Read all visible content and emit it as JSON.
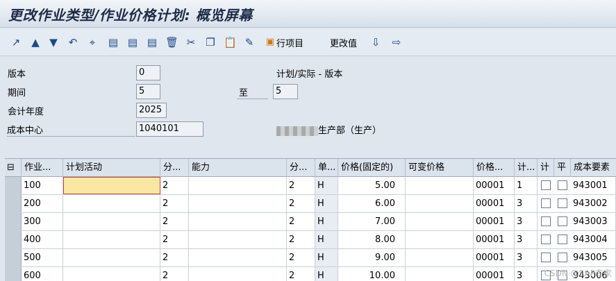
{
  "window": {
    "title": "更改作业类型/作业价格计划: 概览屏幕"
  },
  "toolbar": {
    "icons": [
      "chart-icon",
      "arrow-up-icon",
      "arrow-down-icon",
      "undo-icon",
      "select-icon",
      "doc-icon",
      "doc-icon",
      "doc-icon",
      "delete-icon",
      "cut-icon",
      "copy-icon",
      "paste-icon",
      "edit-icon",
      "line-items-icon"
    ],
    "line_items_label": "行项目",
    "change_value_label": "更改值"
  },
  "header": {
    "version_label": "版本",
    "version_value": "0",
    "plan_actual_label": "计划/实际 - 版本",
    "period_label": "期间",
    "period_from": "5",
    "to_label": "至",
    "period_to": "5",
    "fiscal_year_label": "会计年度",
    "fiscal_year_value": "2025",
    "cost_center_label": "成本中心",
    "cost_center_value": "1040101",
    "cost_center_desc": "生产部（生产）"
  },
  "table": {
    "columns": [
      "作业...",
      "计划活动",
      "分...",
      "能力",
      "分...",
      "单...",
      "价格(固定的)",
      "可变价格",
      "价格...",
      "计...",
      "计",
      "平",
      "成本要素"
    ],
    "rows": [
      {
        "activity": "100",
        "plan": "",
        "d1": "2",
        "cap": "",
        "d2": "2",
        "unit": "H",
        "fixed": "5.00",
        "var": "",
        "pu": "00001",
        "pi": "1",
        "ce": "943001"
      },
      {
        "activity": "200",
        "plan": "",
        "d1": "2",
        "cap": "",
        "d2": "2",
        "unit": "H",
        "fixed": "6.00",
        "var": "",
        "pu": "00001",
        "pi": "3",
        "ce": "943002"
      },
      {
        "activity": "300",
        "plan": "",
        "d1": "2",
        "cap": "",
        "d2": "2",
        "unit": "H",
        "fixed": "7.00",
        "var": "",
        "pu": "00001",
        "pi": "3",
        "ce": "943003"
      },
      {
        "activity": "400",
        "plan": "",
        "d1": "2",
        "cap": "",
        "d2": "2",
        "unit": "H",
        "fixed": "8.00",
        "var": "",
        "pu": "00001",
        "pi": "3",
        "ce": "943004"
      },
      {
        "activity": "500",
        "plan": "",
        "d1": "2",
        "cap": "",
        "d2": "2",
        "unit": "H",
        "fixed": "9.00",
        "var": "",
        "pu": "00001",
        "pi": "3",
        "ce": "943005"
      },
      {
        "activity": "600",
        "plan": "",
        "d1": "2",
        "cap": "",
        "d2": "2",
        "unit": "H",
        "fixed": "10.00",
        "var": "",
        "pu": "00001",
        "pi": "3",
        "ce": "943006"
      }
    ]
  },
  "watermark": "CSDN @SAP专家"
}
